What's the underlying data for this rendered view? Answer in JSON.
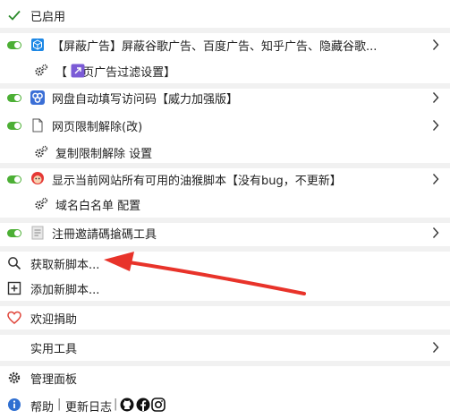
{
  "menu": {
    "enabled_label": "已启用",
    "scripts": [
      {
        "name": "【屏蔽广告】屏蔽谷歌广告、百度广告、知乎广告、隐藏谷歌...",
        "sub": "【 网页广告过滤设置】"
      },
      {
        "name": "网盘自动填写访问码【威力加强版】"
      },
      {
        "name": "网页限制解除(改)",
        "sub": "复制限制解除 设置"
      },
      {
        "name": "显示当前网站所有可用的油猴脚本【没有bug，不更新】",
        "sub": "域名白名单 配置"
      },
      {
        "name": "注冊邀請碼搶碼工具"
      }
    ],
    "find_scripts": "获取新脚本...",
    "add_script": "添加新脚本...",
    "donate": "欢迎捐助",
    "tools": "实用工具",
    "dashboard": "管理面板",
    "help": "帮助",
    "divider": "|",
    "changelog": "更新日志"
  },
  "colors": {
    "toggle_on": "#4caf35",
    "arrow": "#e8332a",
    "heart": "#e0463b"
  }
}
